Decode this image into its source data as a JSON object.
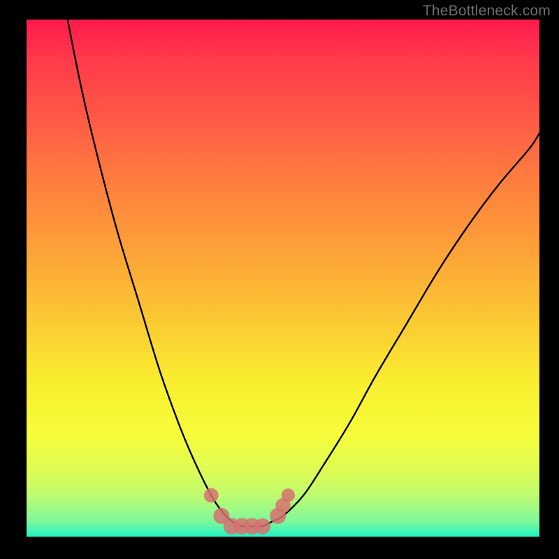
{
  "watermark": "TheBottleneck.com",
  "chart_data": {
    "type": "line",
    "title": "",
    "xlabel": "",
    "ylabel": "",
    "xlim": [
      0,
      100
    ],
    "ylim": [
      0,
      100
    ],
    "series": [
      {
        "name": "bottleneck-curve",
        "x": [
          8,
          10,
          12,
          15,
          18,
          22,
          26,
          30,
          33,
          36,
          38,
          40,
          42,
          44,
          46,
          48,
          50,
          54,
          58,
          63,
          68,
          74,
          80,
          86,
          92,
          98,
          100
        ],
        "y": [
          100,
          90,
          81,
          69,
          58,
          45,
          32,
          21,
          14,
          8,
          5,
          3,
          2,
          2,
          2,
          3,
          4,
          8,
          14,
          22,
          31,
          41,
          51,
          60,
          68,
          75,
          78
        ]
      }
    ],
    "markers": {
      "name": "highlight-points",
      "color": "#d87070",
      "points": [
        {
          "x": 36,
          "y": 8,
          "r": 1.2
        },
        {
          "x": 38,
          "y": 4,
          "r": 1.5
        },
        {
          "x": 40,
          "y": 2,
          "r": 1.6
        },
        {
          "x": 42,
          "y": 2,
          "r": 1.6
        },
        {
          "x": 44,
          "y": 2,
          "r": 1.6
        },
        {
          "x": 46,
          "y": 2,
          "r": 1.5
        },
        {
          "x": 49,
          "y": 4,
          "r": 1.5
        },
        {
          "x": 50,
          "y": 6,
          "r": 1.3
        },
        {
          "x": 51,
          "y": 8,
          "r": 1.0
        }
      ]
    }
  }
}
